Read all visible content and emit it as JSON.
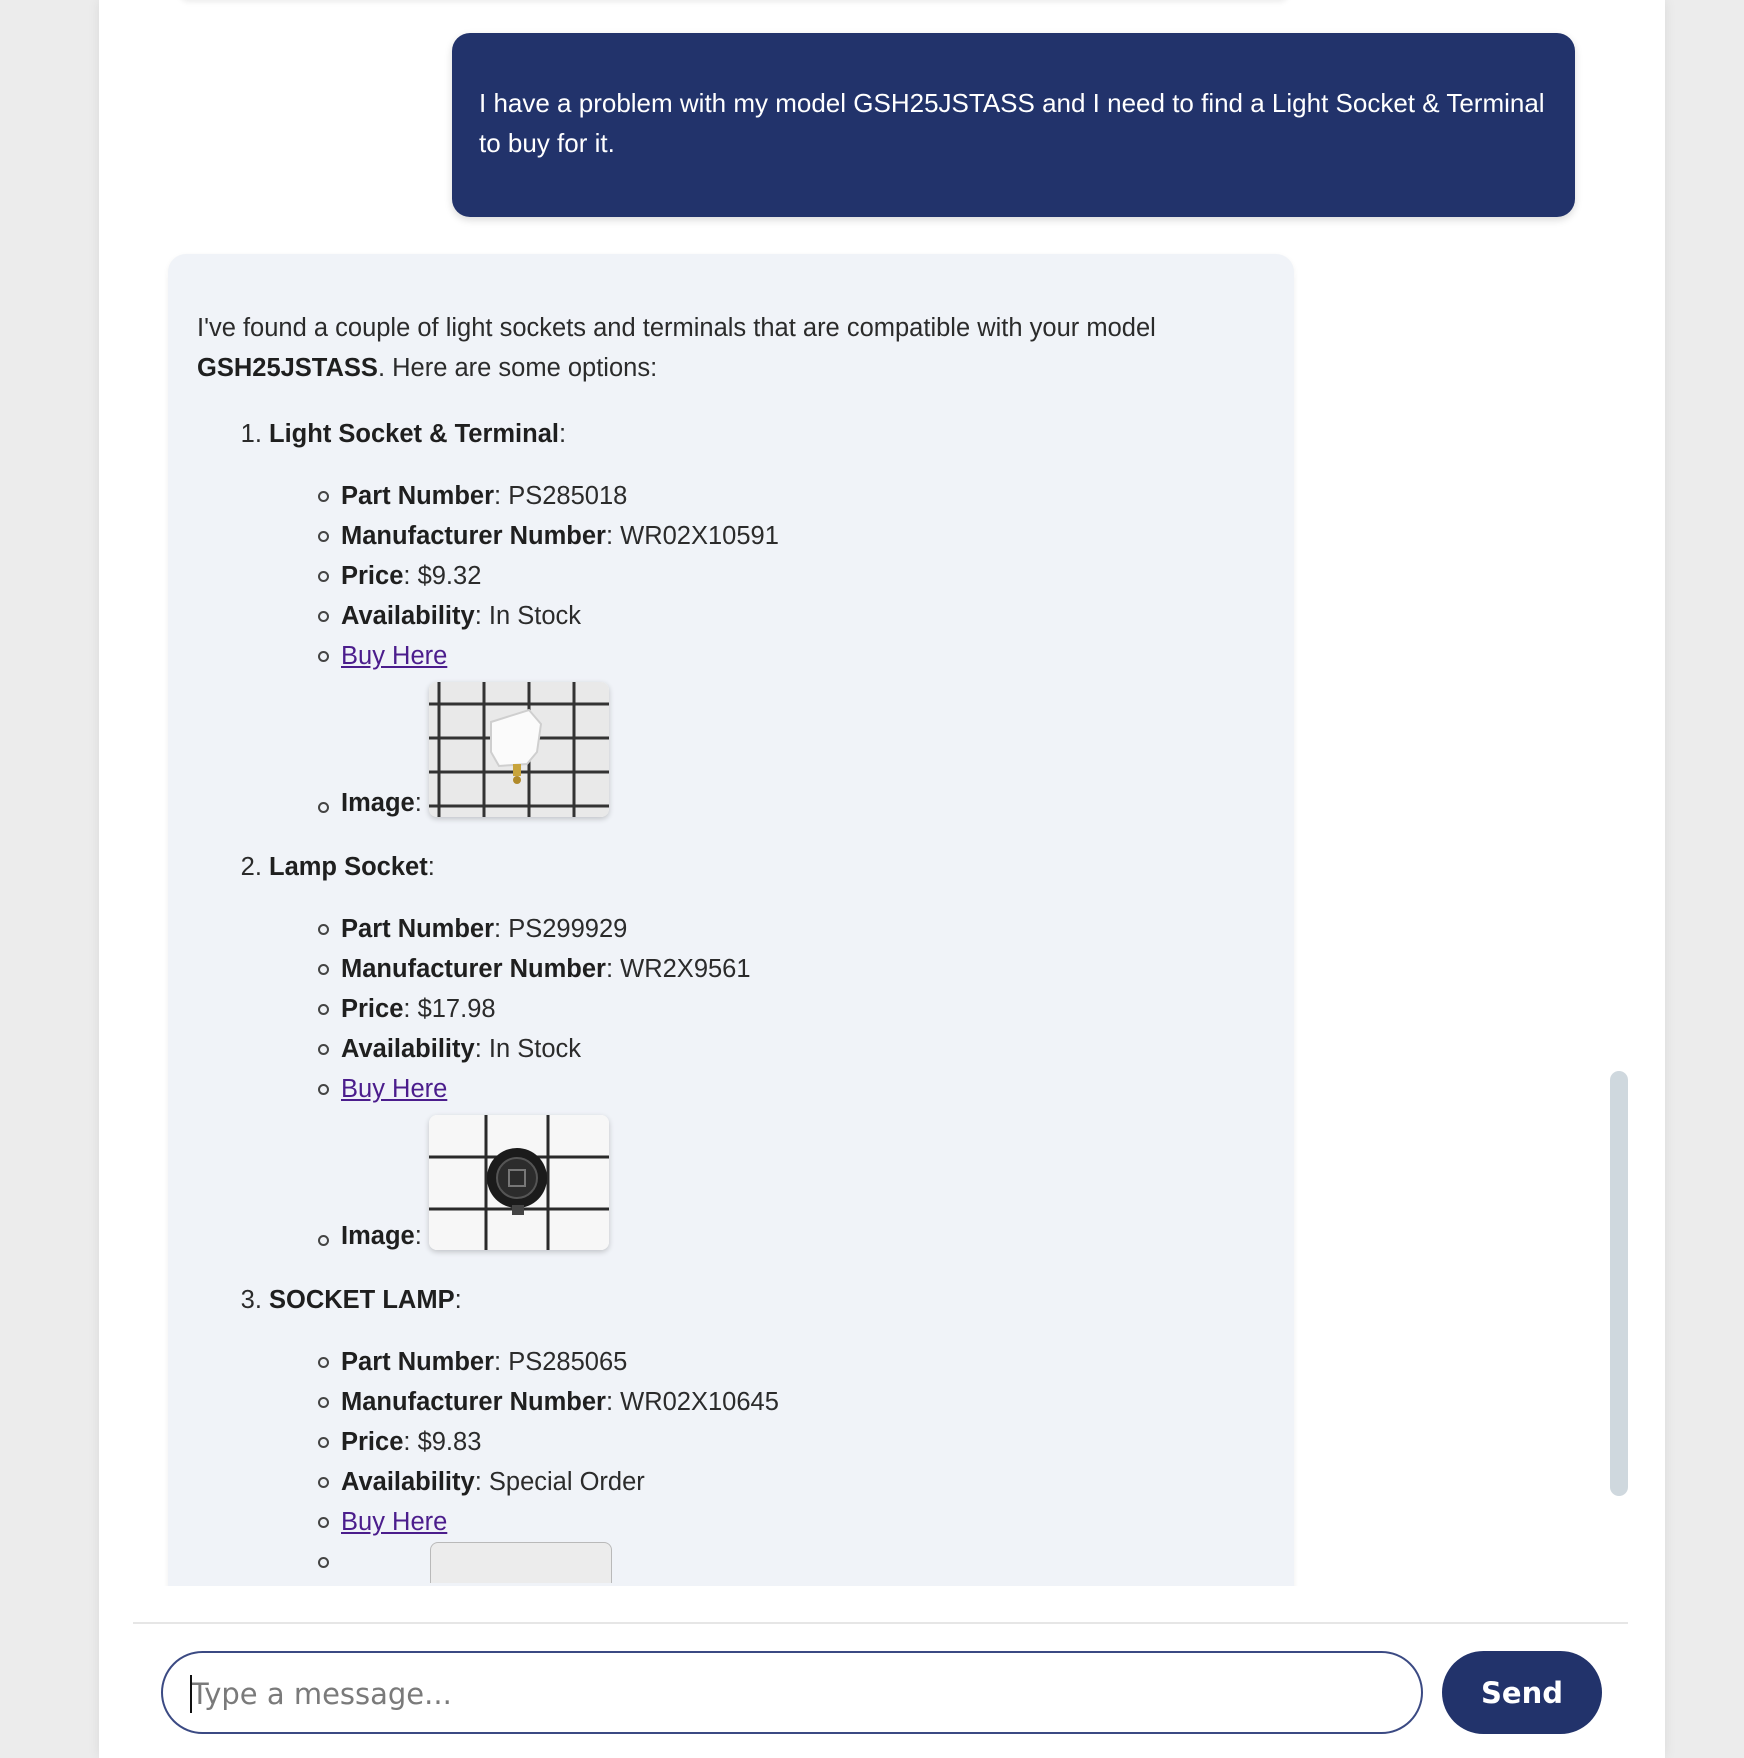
{
  "user_message": {
    "text": "I have a problem with my model GSH25JSTASS and I need to find a Light Socket & Terminal to buy for it."
  },
  "bot_message": {
    "intro_before": "I've found a couple of light sockets and terminals that are compatible with your model ",
    "intro_model": "GSH25JSTASS",
    "intro_after": ". Here are some options:",
    "options": [
      {
        "title": "Light Socket & Terminal",
        "part_number_label": "Part Number",
        "part_number": "PS285018",
        "manufacturer_label": "Manufacturer Number",
        "manufacturer_number": "WR02X10591",
        "price_label": "Price",
        "price": "$9.32",
        "availability_label": "Availability",
        "availability": "In Stock",
        "buy_link": "Buy Here",
        "image_label": "Image"
      },
      {
        "title": "Lamp Socket",
        "part_number_label": "Part Number",
        "part_number": "PS299929",
        "manufacturer_label": "Manufacturer Number",
        "manufacturer_number": "WR2X9561",
        "price_label": "Price",
        "price": "$17.98",
        "availability_label": "Availability",
        "availability": "In Stock",
        "buy_link": "Buy Here",
        "image_label": "Image"
      },
      {
        "title": "SOCKET LAMP",
        "part_number_label": "Part Number",
        "part_number": "PS285065",
        "manufacturer_label": "Manufacturer Number",
        "manufacturer_number": "WR02X10645",
        "price_label": "Price",
        "price": "$9.83",
        "availability_label": "Availability",
        "availability": "Special Order",
        "buy_link": "Buy Here"
      }
    ]
  },
  "composer": {
    "placeholder": "Type a message...",
    "value": "",
    "send_label": "Send"
  },
  "colors": {
    "accent": "#22336b",
    "bot_bubble": "#f0f3f8",
    "link": "#4b1d8c"
  },
  "icons": {
    "thumb_1": "light-socket-terminal-image",
    "thumb_2": "lamp-socket-image"
  }
}
